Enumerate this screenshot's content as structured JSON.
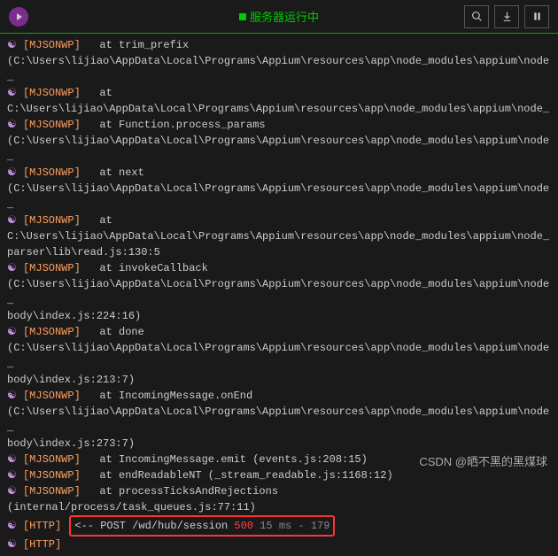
{
  "header": {
    "status_text": "服务器运行中"
  },
  "logs": {
    "prompt": "☯",
    "mjsonwp": "[MJSONWP]",
    "http": "[HTTP]",
    "lines": [
      {
        "tag": "mjsonwp",
        "text": "   at trim_prefix"
      },
      {
        "tag": "path",
        "text": "(C:\\Users\\lijiao\\AppData\\Local\\Programs\\Appium\\resources\\app\\node_modules\\appium\\node_"
      },
      {
        "tag": "mjsonwp",
        "text": "   at"
      },
      {
        "tag": "path",
        "text": "C:\\Users\\lijiao\\AppData\\Local\\Programs\\Appium\\resources\\app\\node_modules\\appium\\node_"
      },
      {
        "tag": "mjsonwp",
        "text": "   at Function.process_params"
      },
      {
        "tag": "path",
        "text": "(C:\\Users\\lijiao\\AppData\\Local\\Programs\\Appium\\resources\\app\\node_modules\\appium\\node_"
      },
      {
        "tag": "mjsonwp",
        "text": "   at next"
      },
      {
        "tag": "path",
        "text": "(C:\\Users\\lijiao\\AppData\\Local\\Programs\\Appium\\resources\\app\\node_modules\\appium\\node_"
      },
      {
        "tag": "mjsonwp",
        "text": "   at"
      },
      {
        "tag": "path",
        "text": "C:\\Users\\lijiao\\AppData\\Local\\Programs\\Appium\\resources\\app\\node_modules\\appium\\node_"
      },
      {
        "tag": "path",
        "text": "parser\\lib\\read.js:130:5"
      },
      {
        "tag": "mjsonwp",
        "text": "   at invokeCallback"
      },
      {
        "tag": "path",
        "text": "(C:\\Users\\lijiao\\AppData\\Local\\Programs\\Appium\\resources\\app\\node_modules\\appium\\node_"
      },
      {
        "tag": "path",
        "text": "body\\index.js:224:16)"
      },
      {
        "tag": "mjsonwp",
        "text": "   at done"
      },
      {
        "tag": "path",
        "text": "(C:\\Users\\lijiao\\AppData\\Local\\Programs\\Appium\\resources\\app\\node_modules\\appium\\node_"
      },
      {
        "tag": "path",
        "text": "body\\index.js:213:7)"
      },
      {
        "tag": "mjsonwp",
        "text": "   at IncomingMessage.onEnd"
      },
      {
        "tag": "path",
        "text": "(C:\\Users\\lijiao\\AppData\\Local\\Programs\\Appium\\resources\\app\\node_modules\\appium\\node_"
      },
      {
        "tag": "path",
        "text": "body\\index.js:273:7)"
      },
      {
        "tag": "mjsonwp",
        "text": "   at IncomingMessage.emit (events.js:208:15)"
      },
      {
        "tag": "mjsonwp",
        "text": "   at endReadableNT (_stream_readable.js:1168:12)"
      },
      {
        "tag": "mjsonwp",
        "text": "   at processTicksAndRejections"
      },
      {
        "tag": "path",
        "text": "(internal/process/task_queues.js:77:11)"
      }
    ],
    "http_line": {
      "arrow": "<-- POST /wd/hub/session",
      "status": "500",
      "timing": "15 ms - 179"
    }
  },
  "watermark": "CSDN @晒不黑的黑煤球"
}
